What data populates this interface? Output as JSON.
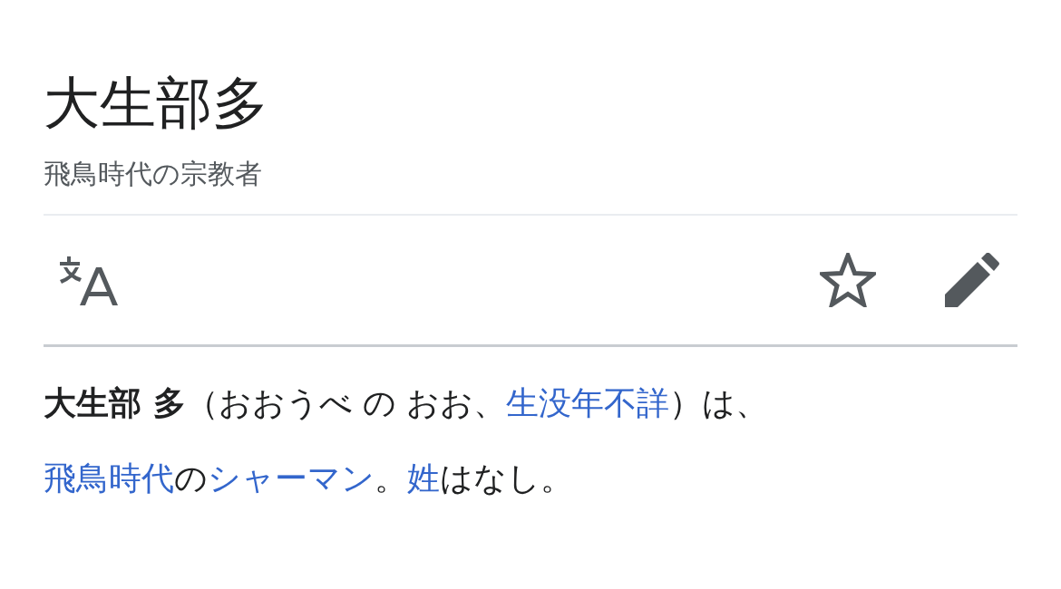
{
  "title": "大生部多",
  "subtitle": "飛鳥時代の宗教者",
  "paragraph": [
    {
      "kind": "text",
      "text": "**大生部 多**（おおうべ の おお、"
    },
    {
      "kind": "link",
      "text": "生没年不詳"
    },
    {
      "kind": "text",
      "text": "）は、"
    },
    {
      "kind": "break"
    },
    {
      "kind": "link",
      "text": "飛鳥時代"
    },
    {
      "kind": "text",
      "text": "の"
    },
    {
      "kind": "link",
      "text": "シャーマン"
    },
    {
      "kind": "text",
      "text": "。"
    },
    {
      "kind": "link",
      "text": "姓"
    },
    {
      "kind": "text",
      "text": "はなし。"
    }
  ]
}
